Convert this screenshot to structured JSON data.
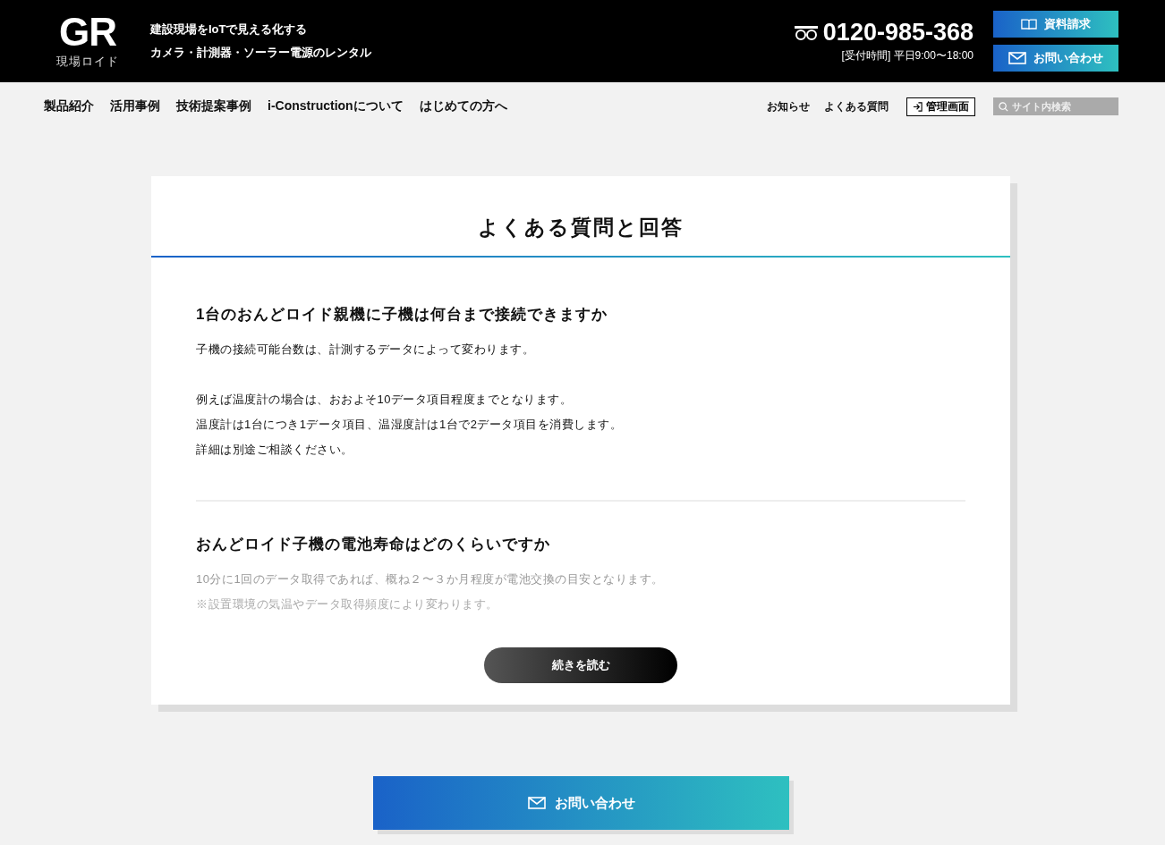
{
  "header": {
    "logo": {
      "mark": "GR",
      "sub": "現場ロイド"
    },
    "tagline": [
      "建設現場をIoTで見える化する",
      "カメラ・計測器・ソーラー電源のレンタル"
    ],
    "phone": {
      "number": "0120-985-368",
      "hours": "[受付時間] 平日9:00〜18:00"
    },
    "buttons": [
      {
        "label": "資料請求",
        "kind": "brochure"
      },
      {
        "label": "お問い合わせ",
        "kind": "contact"
      }
    ]
  },
  "nav": {
    "main": [
      "製品紹介",
      "活用事例",
      "技術提案事例",
      "i-Constructionについて",
      "はじめての方へ"
    ],
    "sub": [
      "お知らせ",
      "よくある質問"
    ],
    "admin": "管理画面",
    "search": {
      "placeholder": "サイト内検索"
    }
  },
  "faq": {
    "title": "よくある質問と回答",
    "items": [
      {
        "question": "1台のおんどロイド親機に子機は何台まで接続できますか",
        "paragraphs": [
          [
            "子機の接続可能台数は、計測するデータによって変わります。"
          ],
          [
            "例えば温度計の場合は、おおよそ10データ項目程度までとなります。",
            "温度計は1台につき1データ項目、温湿度計は1台で2データ項目を消費します。",
            "詳細は別途ご相談ください。"
          ]
        ],
        "faded": false
      },
      {
        "question": "おんどロイド子機の電池寿命はどのくらいですか",
        "paragraphs": [
          [
            "10分に1回のデータ取得であれば、概ね２〜３か月程度が電池交換の目安となります。",
            "※設置環境の気温やデータ取得頻度により変わります。"
          ]
        ],
        "faded": true
      }
    ],
    "more": "続きを読む"
  },
  "cta": {
    "label": "お問い合わせ"
  }
}
